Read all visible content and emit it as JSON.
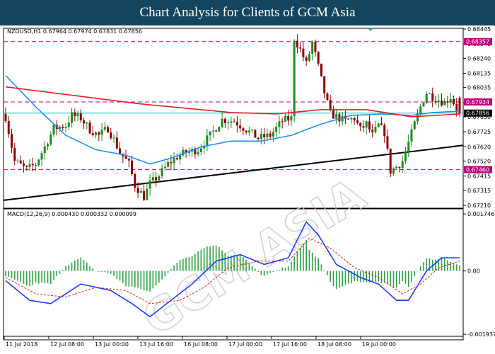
{
  "banner": {
    "title": "Chart Analysis for Clients of GCM Asia"
  },
  "colors": {
    "up": "#1e8a1e",
    "down": "#8b0000",
    "ma_fast": "#1e90ff",
    "ma_slow": "#e02020",
    "level_line": "#c0007a",
    "current_line": "#00c0c0",
    "trendline": "#000000",
    "macd_hist": "#2ea043",
    "macd_line": "#1e3cff",
    "macd_signal": "#e02020",
    "banner_bg": "#15465f"
  },
  "chart_data": [
    {
      "type": "candlestick",
      "header": "NZDUSD,H1  0.67964 0.67974 0.67831 0.67856",
      "symbol": "NZDUSD",
      "timeframe": "H1",
      "ohlc_last": {
        "open": 0.67964,
        "high": 0.67974,
        "low": 0.67831,
        "close": 0.67856
      },
      "ylim": [
        0.6719,
        0.6845
      ],
      "y_ticks": [
        0.68445,
        0.6834,
        0.6824,
        0.68135,
        0.68035,
        0.6793,
        0.6783,
        0.67725,
        0.6762,
        0.6752,
        0.67415,
        0.67315,
        0.6721
      ],
      "y_tick_labels": [
        "0.68445",
        "0.68340",
        "0.68240",
        "0.68135",
        "0.68035",
        "0.67930",
        "0.67830",
        "0.67725",
        "0.67620",
        "0.67520",
        "0.67415",
        "0.67315",
        "0.67210"
      ],
      "x_tick_labels": [
        "11 Jul 2018",
        "12 Jul 08:00",
        "13 Jul 00:00",
        "13 Jul 16:00",
        "16 Jul 08:00",
        "17 Jul 00:00",
        "17 Jul 16:00",
        "18 Jul 08:00",
        "19 Jul 00:00"
      ],
      "levels": [
        {
          "value": 0.68357,
          "label": "0.68357"
        },
        {
          "value": 0.67934,
          "label": "0.67934"
        },
        {
          "value": 0.6746,
          "label": "0.67460"
        }
      ],
      "current_price": {
        "value": 0.67856,
        "label": "0.67856"
      },
      "trendline": {
        "start": 0.67245,
        "end": 0.6763
      },
      "close_path": [
        [
          0,
          0.6783
        ],
        [
          3,
          0.6752
        ],
        [
          7,
          0.6746
        ],
        [
          10,
          0.675
        ],
        [
          13,
          0.6762
        ],
        [
          16,
          0.6775
        ],
        [
          20,
          0.6777
        ],
        [
          22,
          0.6784
        ],
        [
          25,
          0.6782
        ],
        [
          28,
          0.6774
        ],
        [
          31,
          0.677
        ],
        [
          34,
          0.6775
        ],
        [
          36,
          0.6767
        ],
        [
          38,
          0.6758
        ],
        [
          41,
          0.675
        ],
        [
          43,
          0.6735
        ],
        [
          46,
          0.6727
        ],
        [
          48,
          0.6736
        ],
        [
          51,
          0.6742
        ],
        [
          54,
          0.675
        ],
        [
          57,
          0.6755
        ],
        [
          60,
          0.6758
        ],
        [
          64,
          0.676
        ],
        [
          68,
          0.677
        ],
        [
          72,
          0.6781
        ],
        [
          76,
          0.678
        ],
        [
          80,
          0.6774
        ],
        [
          84,
          0.6768
        ],
        [
          88,
          0.677
        ],
        [
          92,
          0.678
        ],
        [
          95,
          0.6782
        ],
        [
          96,
          0.6838
        ],
        [
          98,
          0.683
        ],
        [
          100,
          0.682
        ],
        [
          102,
          0.6835
        ],
        [
          104,
          0.6818
        ],
        [
          106,
          0.68
        ],
        [
          108,
          0.6785
        ],
        [
          110,
          0.6783
        ],
        [
          113,
          0.678
        ],
        [
          116,
          0.6782
        ],
        [
          118,
          0.6774
        ],
        [
          120,
          0.6778
        ],
        [
          122,
          0.677
        ],
        [
          124,
          0.6777
        ],
        [
          126,
          0.6772
        ],
        [
          128,
          0.6745
        ],
        [
          130,
          0.6748
        ],
        [
          132,
          0.6752
        ],
        [
          134,
          0.6765
        ],
        [
          136,
          0.6778
        ],
        [
          138,
          0.679
        ],
        [
          140,
          0.68
        ],
        [
          142,
          0.6797
        ],
        [
          144,
          0.6795
        ],
        [
          146,
          0.6793
        ],
        [
          148,
          0.6797
        ],
        [
          150,
          0.6789
        ],
        [
          151,
          0.6786
        ]
      ],
      "series": [
        {
          "values": [
            [
              0,
              0.6812
            ],
            [
              10,
              0.679
            ],
            [
              20,
              0.677
            ],
            [
              30,
              0.676
            ],
            [
              40,
              0.6756
            ],
            [
              48,
              0.675
            ],
            [
              55,
              0.6754
            ],
            [
              65,
              0.6762
            ],
            [
              75,
              0.6766
            ],
            [
              85,
              0.6766
            ],
            [
              95,
              0.677
            ],
            [
              105,
              0.6778
            ],
            [
              115,
              0.6784
            ],
            [
              125,
              0.6785
            ],
            [
              135,
              0.6784
            ],
            [
              142,
              0.6786
            ],
            [
              151,
              0.6787
            ]
          ]
        },
        {
          "values": [
            [
              0,
              0.6804
            ],
            [
              15,
              0.68
            ],
            [
              30,
              0.6796
            ],
            [
              45,
              0.6792
            ],
            [
              60,
              0.6789
            ],
            [
              75,
              0.6786
            ],
            [
              90,
              0.6785
            ],
            [
              105,
              0.6788
            ],
            [
              120,
              0.6788
            ],
            [
              135,
              0.6783
            ],
            [
              151,
              0.6785
            ]
          ]
        }
      ]
    },
    {
      "type": "bar",
      "header": "MACD(12,26,9) 0.000430 0.000332 0.000099",
      "params": "12,26,9",
      "readings": [
        0.00043,
        0.000332,
        9.9e-05
      ],
      "ylim": [
        -0.002,
        0.0019
      ],
      "y_ticks": [
        0.001746,
        0.0,
        -0.001937
      ],
      "y_tick_labels": [
        "0.001746",
        "0.00",
        "-0.001937"
      ],
      "series": [
        {
          "values": [
            [
              0,
              -0.0003
            ],
            [
              8,
              -0.0009
            ],
            [
              15,
              -0.001
            ],
            [
              25,
              -0.0004
            ],
            [
              35,
              -0.0006
            ],
            [
              42,
              -0.001
            ],
            [
              48,
              -0.0014
            ],
            [
              55,
              -0.0009
            ],
            [
              62,
              -0.0004
            ],
            [
              70,
              0.0003
            ],
            [
              78,
              0.0005
            ],
            [
              86,
              0.0002
            ],
            [
              94,
              0.0004
            ],
            [
              100,
              0.0015
            ],
            [
              104,
              0.0011
            ],
            [
              110,
              0.0002
            ],
            [
              118,
              -0.0002
            ],
            [
              124,
              -0.0004
            ],
            [
              130,
              -0.0009
            ],
            [
              134,
              -0.0009
            ],
            [
              140,
              0.0
            ],
            [
              145,
              0.0004
            ],
            [
              151,
              0.0004
            ]
          ]
        },
        {
          "values": [
            [
              0,
              -0.0002
            ],
            [
              10,
              -0.0007
            ],
            [
              20,
              -0.0008
            ],
            [
              30,
              -0.0005
            ],
            [
              40,
              -0.0006
            ],
            [
              48,
              -0.001
            ],
            [
              58,
              -0.0009
            ],
            [
              66,
              -0.0005
            ],
            [
              74,
              0.0001
            ],
            [
              84,
              0.0003
            ],
            [
              94,
              0.0003
            ],
            [
              101,
              0.001
            ],
            [
              108,
              0.0007
            ],
            [
              116,
              0.0001
            ],
            [
              124,
              -0.0002
            ],
            [
              132,
              -0.0007
            ],
            [
              138,
              -0.0004
            ],
            [
              144,
              0.0001
            ],
            [
              151,
              0.0003
            ]
          ]
        }
      ]
    }
  ]
}
